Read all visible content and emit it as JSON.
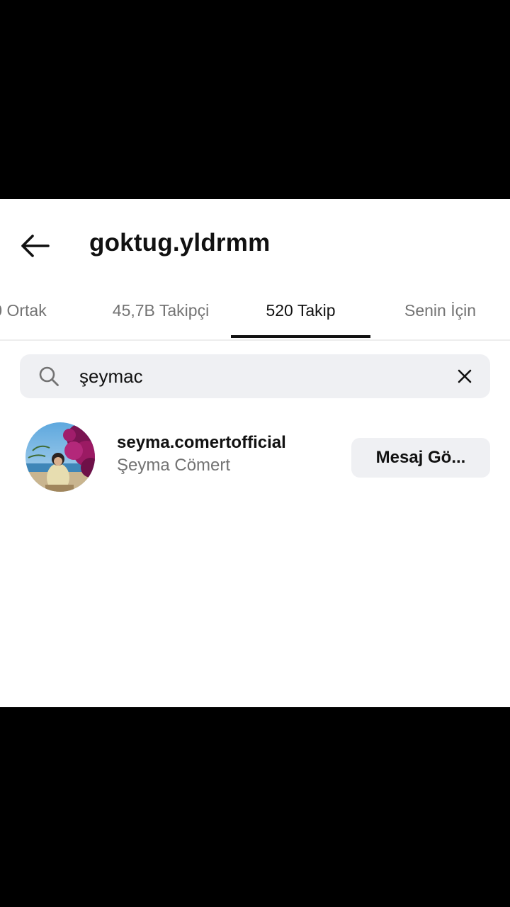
{
  "header": {
    "title": "goktug.yldrmm"
  },
  "tabs": [
    {
      "label": "0 Ortak"
    },
    {
      "label": "45,7B Takipçi"
    },
    {
      "label": "520 Takip",
      "active": true
    },
    {
      "label": "Senin İçin"
    }
  ],
  "search": {
    "value": "şeymac"
  },
  "results": [
    {
      "username": "seyma.comertofficial",
      "full_name": "Şeyma Cömert",
      "button_label": "Mesaj Gö..."
    }
  ],
  "icons": {
    "back": "arrow-left-icon",
    "search": "search-icon",
    "clear": "close-icon"
  },
  "colors": {
    "text_primary": "#111111",
    "text_secondary": "#737373",
    "surface": "#eff0f3"
  }
}
